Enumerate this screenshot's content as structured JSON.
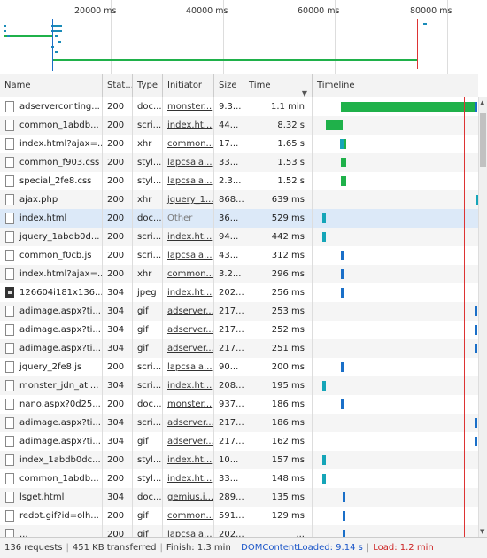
{
  "overview": {
    "ticks": [
      "20000 ms",
      "40000 ms",
      "60000 ms",
      "80000 ms"
    ]
  },
  "columns": {
    "name": "Name",
    "status": "Stat...",
    "type": "Type",
    "initiator": "Initiator",
    "size": "Size",
    "time": "Time",
    "timeline": "Timeline"
  },
  "rows": [
    {
      "name": "adserverconting...",
      "status": "200",
      "type": "doc...",
      "initiator": "monster...",
      "size": "9.3...",
      "time": "1.1 min",
      "icon": "doc",
      "wf": "green",
      "wf_start": 0.17,
      "wf_end": 0.98,
      "tail": 0.98
    },
    {
      "name": "common_1abdb...",
      "status": "200",
      "type": "scri...",
      "initiator": "index.ht...",
      "size": "44...",
      "time": "8.32 s",
      "icon": "doc",
      "wf": "green",
      "wf_start": 0.08,
      "wf_end": 0.18
    },
    {
      "name": "index.html?ajax=...",
      "status": "200",
      "type": "xhr",
      "initiator": "common...",
      "size": "17...",
      "time": "1.65 s",
      "icon": "doc",
      "wf": "green",
      "wf_start": 0.17,
      "wf_end": 0.2,
      "teal": 0.165
    },
    {
      "name": "common_f903.css",
      "status": "200",
      "type": "styl...",
      "initiator": "lapcsala...",
      "size": "33...",
      "time": "1.53 s",
      "icon": "doc",
      "wf": "green",
      "wf_start": 0.17,
      "wf_end": 0.2
    },
    {
      "name": "special_2fe8.css",
      "status": "200",
      "type": "styl...",
      "initiator": "lapcsala...",
      "size": "2.3...",
      "time": "1.52 s",
      "icon": "doc",
      "wf": "green",
      "wf_start": 0.17,
      "wf_end": 0.2
    },
    {
      "name": "ajax.php",
      "status": "200",
      "type": "xhr",
      "initiator": "jquery_1...",
      "size": "868...",
      "time": "639 ms",
      "icon": "doc",
      "wf": "teal",
      "at": 0.99
    },
    {
      "name": "index.html",
      "status": "200",
      "type": "doc...",
      "initiator": "Other",
      "size": "36...",
      "time": "529 ms",
      "icon": "doc",
      "wf": "teal",
      "at": 0.06,
      "selected": true
    },
    {
      "name": "jquery_1abdb0d...",
      "status": "200",
      "type": "scri...",
      "initiator": "index.ht...",
      "size": "94...",
      "time": "442 ms",
      "icon": "doc",
      "wf": "teal",
      "at": 0.06
    },
    {
      "name": "common_f0cb.js",
      "status": "200",
      "type": "scri...",
      "initiator": "lapcsala...",
      "size": "43...",
      "time": "312 ms",
      "icon": "doc",
      "wf": "blue",
      "at": 0.17
    },
    {
      "name": "index.html?ajax=...",
      "status": "200",
      "type": "xhr",
      "initiator": "common...",
      "size": "3.2...",
      "time": "296 ms",
      "icon": "doc",
      "wf": "blue",
      "at": 0.17
    },
    {
      "name": "126604i181x136...",
      "status": "304",
      "type": "jpeg",
      "initiator": "index.ht...",
      "size": "202...",
      "time": "256 ms",
      "icon": "img",
      "wf": "blue",
      "at": 0.17
    },
    {
      "name": "adimage.aspx?ti...",
      "status": "304",
      "type": "gif",
      "initiator": "adserver...",
      "size": "217...",
      "time": "253 ms",
      "icon": "doc",
      "wf": "blue",
      "at": 0.98
    },
    {
      "name": "adimage.aspx?ti...",
      "status": "304",
      "type": "gif",
      "initiator": "adserver...",
      "size": "217...",
      "time": "252 ms",
      "icon": "doc",
      "wf": "blue",
      "at": 0.98
    },
    {
      "name": "adimage.aspx?ti...",
      "status": "304",
      "type": "gif",
      "initiator": "adserver...",
      "size": "217...",
      "time": "251 ms",
      "icon": "dash",
      "wf": "blue",
      "at": 0.98
    },
    {
      "name": "jquery_2fe8.js",
      "status": "200",
      "type": "scri...",
      "initiator": "lapcsala...",
      "size": "90...",
      "time": "200 ms",
      "icon": "doc",
      "wf": "blue",
      "at": 0.17
    },
    {
      "name": "monster_jdn_atl...",
      "status": "304",
      "type": "scri...",
      "initiator": "index.ht...",
      "size": "208...",
      "time": "195 ms",
      "icon": "doc",
      "wf": "teal",
      "at": 0.06
    },
    {
      "name": "nano.aspx?0d25...",
      "status": "200",
      "type": "doc...",
      "initiator": "monster...",
      "size": "937...",
      "time": "186 ms",
      "icon": "doc",
      "wf": "blue",
      "at": 0.17
    },
    {
      "name": "adimage.aspx?ti...",
      "status": "304",
      "type": "scri...",
      "initiator": "adserver...",
      "size": "217...",
      "time": "186 ms",
      "icon": "doc",
      "wf": "blue",
      "at": 0.98
    },
    {
      "name": "adimage.aspx?ti...",
      "status": "304",
      "type": "gif",
      "initiator": "adserver...",
      "size": "217...",
      "time": "162 ms",
      "icon": "doc",
      "wf": "blue",
      "at": 0.98
    },
    {
      "name": "index_1abdb0dc...",
      "status": "200",
      "type": "styl...",
      "initiator": "index.ht...",
      "size": "10...",
      "time": "157 ms",
      "icon": "doc",
      "wf": "teal",
      "at": 0.06
    },
    {
      "name": "common_1abdb...",
      "status": "200",
      "type": "styl...",
      "initiator": "index.ht...",
      "size": "33...",
      "time": "148 ms",
      "icon": "doc",
      "wf": "teal",
      "at": 0.06
    },
    {
      "name": "lsget.html",
      "status": "304",
      "type": "doc...",
      "initiator": "gemius.i...",
      "size": "289...",
      "time": "135 ms",
      "icon": "doc",
      "wf": "blue",
      "at": 0.18
    },
    {
      "name": "redot.gif?id=olh...",
      "status": "200",
      "type": "gif",
      "initiator": "common...",
      "size": "591...",
      "time": "129 ms",
      "icon": "doc",
      "wf": "blue",
      "at": 0.18
    },
    {
      "name": "...",
      "status": "200",
      "type": "gif",
      "initiator": "lapcsala...",
      "size": "202...",
      "time": "...",
      "icon": "doc",
      "wf": "blue",
      "at": 0.18
    }
  ],
  "status": {
    "requests": "136 requests",
    "transferred": "451 KB transferred",
    "finish": "Finish: 1.3 min",
    "dom": "DOMContentLoaded: 9.14 s",
    "load": "Load: 1.2 min"
  }
}
